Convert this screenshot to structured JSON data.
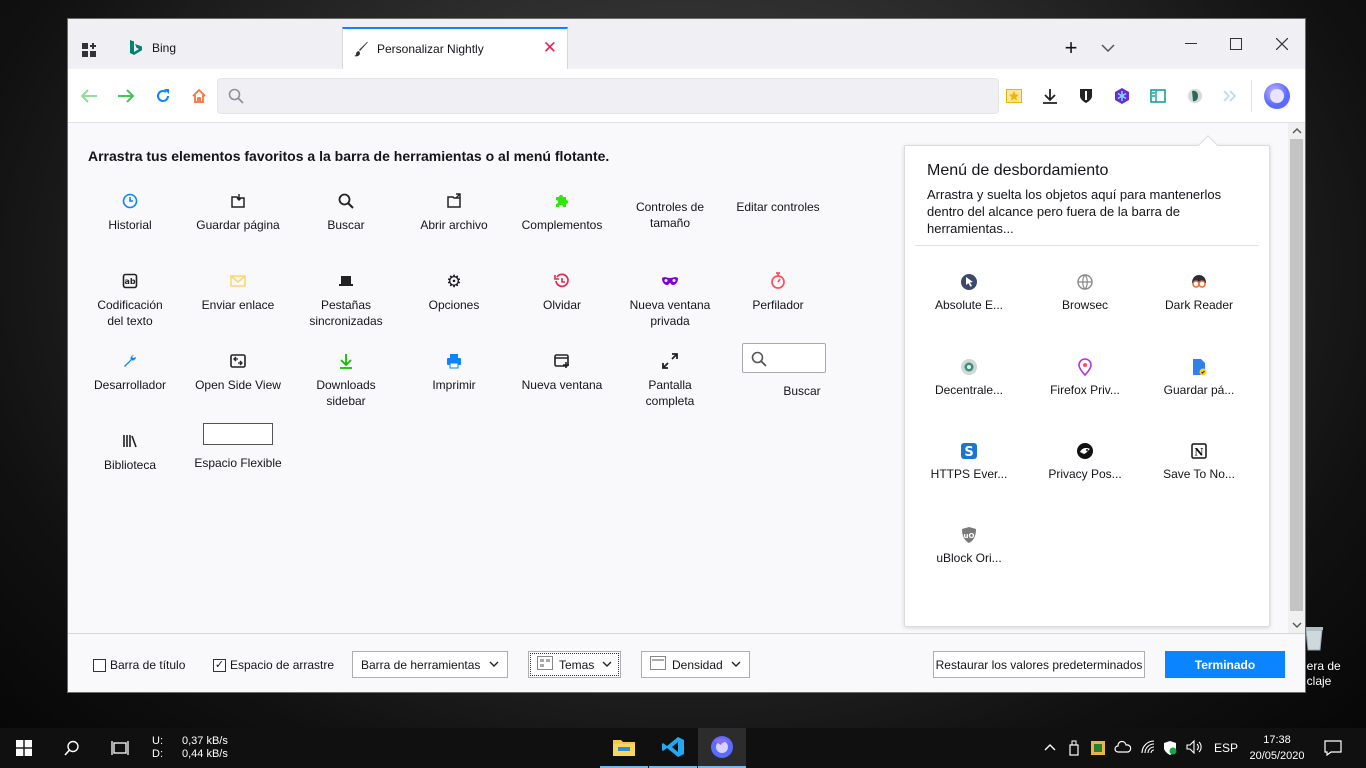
{
  "desktop": {
    "recycle_bin_label": "lera de\niclaje"
  },
  "tabs": [
    {
      "title": "Bing"
    },
    {
      "title": "Personalizar Nightly"
    }
  ],
  "content": {
    "instructions": "Arrastra tus elementos favoritos a la barra de herramientas o al menú flotante.",
    "palette": [
      {
        "label": "Historial",
        "icon": "clock-icon"
      },
      {
        "label": "Guardar página",
        "icon": "save-page-icon"
      },
      {
        "label": "Buscar",
        "icon": "search-icon"
      },
      {
        "label": "Abrir archivo",
        "icon": "open-file-icon"
      },
      {
        "label": "Complementos",
        "icon": "puzzle-icon"
      },
      {
        "label": "Controles de\ntamaño",
        "icon": "zoom-icon"
      },
      {
        "label": "Editar controles",
        "icon": "edit-icon"
      },
      {
        "label": "Codificación\ndel texto",
        "icon": "text-encoding-icon"
      },
      {
        "label": "Enviar enlace",
        "icon": "email-icon"
      },
      {
        "label": "Pestañas\nsincronizadas",
        "icon": "synced-tabs-icon"
      },
      {
        "label": "Opciones",
        "icon": "gear-icon"
      },
      {
        "label": "Olvidar",
        "icon": "forget-icon"
      },
      {
        "label": "Nueva ventana\nprivada",
        "icon": "private-mask-icon"
      },
      {
        "label": "Perfilador",
        "icon": "stopwatch-icon"
      },
      {
        "label": "Desarrollador",
        "icon": "wrench-icon"
      },
      {
        "label": "Open Side View",
        "icon": "side-view-icon"
      },
      {
        "label": "Downloads\nsidebar",
        "icon": "download-icon"
      },
      {
        "label": "Imprimir",
        "icon": "printer-icon"
      },
      {
        "label": "Nueva ventana",
        "icon": "new-window-icon"
      },
      {
        "label": "Pantalla\ncompleta",
        "icon": "fullscreen-icon"
      },
      {
        "label": "Buscar",
        "icon": "search-box-icon"
      },
      {
        "label": "Biblioteca",
        "icon": "library-icon"
      },
      {
        "label": "Espacio Flexible",
        "icon": "flexible-space-icon"
      }
    ]
  },
  "overflow": {
    "title": "Menú de desbordamiento",
    "description": "Arrastra y suelta los objetos aquí para mantenerlos dentro del alcance pero fuera de la barra de herramientas...",
    "items": [
      {
        "label": "Absolute E...",
        "icon": "cursor-icon"
      },
      {
        "label": "Browsec",
        "icon": "globe-icon"
      },
      {
        "label": "Dark Reader",
        "icon": "dark-reader-icon"
      },
      {
        "label": "Decentrale...",
        "icon": "decentraleyes-icon"
      },
      {
        "label": "Firefox Priv...",
        "icon": "location-pin-icon"
      },
      {
        "label": "Guardar pá...",
        "icon": "save-to-file-icon"
      },
      {
        "label": "HTTPS Ever...",
        "icon": "https-everywhere-icon"
      },
      {
        "label": "Privacy Pos...",
        "icon": "privacy-possum-icon"
      },
      {
        "label": "Save To No...",
        "icon": "notion-icon"
      },
      {
        "label": "uBlock Ori...",
        "icon": "ublock-shield-icon"
      }
    ]
  },
  "footer": {
    "title_bar_label": "Barra de título",
    "title_bar_checked": false,
    "drag_space_label": "Espacio de arrastre",
    "drag_space_checked": true,
    "toolbars_label": "Barra de herramientas",
    "themes_label": "Temas",
    "density_label": "Densidad",
    "restore_label": "Restaurar los valores predeterminados",
    "done_label": "Terminado"
  },
  "taskbar": {
    "upload_key": "U:",
    "upload_value": "0,37 kB/s",
    "download_key": "D:",
    "download_value": "0,44 kB/s",
    "language": "ESP",
    "time": "17:38",
    "date": "20/05/2020"
  },
  "colors": {
    "accent": "#0a84ff",
    "close_tab": "#e22850",
    "puzzle": "#30e60b",
    "forget": "#e22850",
    "private": "#8000d7",
    "profiler": "#ff4f5e",
    "dev": "#0a84ff",
    "download_sidebar": "#12bc00",
    "print": "#0a84ff"
  }
}
